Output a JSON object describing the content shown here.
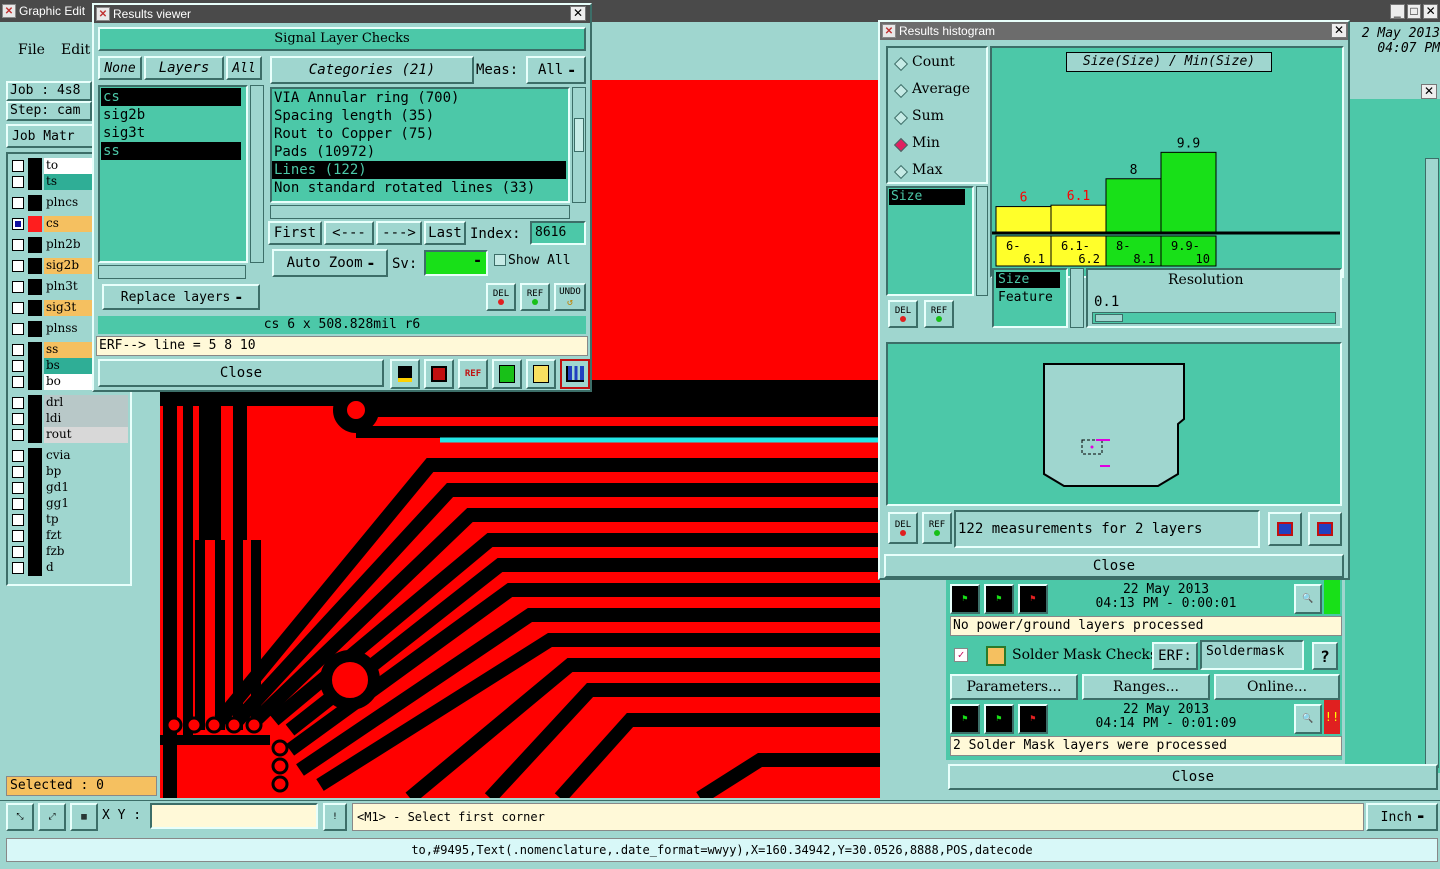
{
  "graphic_editor": {
    "title": "Graphic Edit",
    "menu": [
      "File",
      "Edit"
    ],
    "job_label": "Job : 4s8",
    "step_label": "Step: cam",
    "job_matrix_button": "Job Matr",
    "layers": [
      {
        "name": "to",
        "swatch": "#000000",
        "bg": "#ffffff",
        "checked": false
      },
      {
        "name": "ts",
        "swatch": "#000000",
        "bg": "#2fae96",
        "checked": false
      },
      {
        "name": "plncs",
        "swatch": "#000000",
        "bg": "#9fd6cf",
        "checked": false
      },
      {
        "name": "cs",
        "swatch": "#ff1e1e",
        "bg": "#f5c060",
        "checked": true
      },
      {
        "name": "pln2b",
        "swatch": "#000000",
        "bg": "#9fd6cf",
        "checked": false
      },
      {
        "name": "sig2b",
        "swatch": "#000000",
        "bg": "#f5c060",
        "checked": false
      },
      {
        "name": "pln3t",
        "swatch": "#000000",
        "bg": "#9fd6cf",
        "checked": false
      },
      {
        "name": "sig3t",
        "swatch": "#000000",
        "bg": "#f5c060",
        "checked": false
      },
      {
        "name": "plnss",
        "swatch": "#000000",
        "bg": "#9fd6cf",
        "checked": false
      },
      {
        "name": "ss",
        "swatch": "#000000",
        "bg": "#f5c060",
        "checked": false
      },
      {
        "name": "bs",
        "swatch": "#000000",
        "bg": "#2fae96",
        "checked": false
      },
      {
        "name": "bo",
        "swatch": "#000000",
        "bg": "#ffffff",
        "checked": false
      },
      {
        "name": "drl",
        "swatch": "#000000",
        "bg": "#b8c8c8",
        "checked": false
      },
      {
        "name": "ldi",
        "swatch": "#000000",
        "bg": "#b8c8c8",
        "checked": false
      },
      {
        "name": "rout",
        "swatch": "#000000",
        "bg": "#d8d8d8",
        "checked": false
      },
      {
        "name": "cvia",
        "swatch": "#000000",
        "bg": "#9fd6cf",
        "checked": false
      },
      {
        "name": "bp",
        "swatch": "#000000",
        "bg": "#9fd6cf",
        "checked": false
      },
      {
        "name": "gd1",
        "swatch": "#000000",
        "bg": "#9fd6cf",
        "checked": false
      },
      {
        "name": "gg1",
        "swatch": "#000000",
        "bg": "#9fd6cf",
        "checked": false
      },
      {
        "name": "tp",
        "swatch": "#000000",
        "bg": "#9fd6cf",
        "checked": false
      },
      {
        "name": "fzt",
        "swatch": "#000000",
        "bg": "#9fd6cf",
        "checked": false
      },
      {
        "name": "fzb",
        "swatch": "#000000",
        "bg": "#9fd6cf",
        "checked": false
      },
      {
        "name": "d",
        "swatch": "#000000",
        "bg": "#9fd6cf",
        "checked": false
      }
    ],
    "selected_label": "Selected : 0",
    "date_line1": "2 May 2013",
    "date_line2": "04:07 PM",
    "xy_label": "X Y :",
    "xy_value": "",
    "prompt": "<M1> - Select first corner",
    "units": "Inch",
    "status_line": "to,#9495,Text(.nomenclature,.date_format=wwyy),X=160.34942,Y=30.0526,8888,POS,datecode"
  },
  "results_viewer": {
    "title": "Results viewer",
    "header": "Signal Layer Checks",
    "none_btn": "None",
    "layers_btn": "Layers",
    "all_btn": "All",
    "categories_btn": "Categories (21)",
    "meas_label": "Meas:",
    "meas_value": "All",
    "layer_list": [
      {
        "name": "cs",
        "selected": true
      },
      {
        "name": "sig2b",
        "selected": false
      },
      {
        "name": "sig3t",
        "selected": false
      },
      {
        "name": "ss",
        "selected": true
      }
    ],
    "categories": [
      {
        "name": "VIA Annular ring (700)",
        "selected": false
      },
      {
        "name": "Spacing length (35)",
        "selected": false
      },
      {
        "name": "Rout to Copper (75)",
        "selected": false
      },
      {
        "name": "Pads (10972)",
        "selected": false
      },
      {
        "name": "Lines (122)",
        "selected": true
      },
      {
        "name": "Non standard rotated lines (33)",
        "selected": false
      }
    ],
    "first_btn": "First",
    "prev_btn": "<---",
    "next_btn": "--->",
    "last_btn": "Last",
    "index_label": "Index:",
    "index_value": "8616",
    "auto_zoom": "Auto Zoom",
    "sv_label": "Sv:",
    "show_all": "Show All",
    "replace_layers": "Replace layers",
    "del_label": "DEL",
    "ref_label": "REF",
    "undo_label": "UNDO",
    "measurement": "cs 6 x 508.828mil  r6",
    "erf_line": "ERF--> line = 5 8 10",
    "close_btn": "Close"
  },
  "histogram": {
    "title": "Results histogram",
    "modes": [
      {
        "label": "Count",
        "selected": false
      },
      {
        "label": "Average",
        "selected": false
      },
      {
        "label": "Sum",
        "selected": false
      },
      {
        "label": "Min",
        "selected": true
      },
      {
        "label": "Max",
        "selected": false
      }
    ],
    "list_item": "Size",
    "chart_title": "Size(Size) / Min(Size)",
    "size_label": "Size",
    "feature_label": "Feature",
    "resolution_label": "Resolution",
    "resolution_value": "0.1",
    "summary": "122 measurements for 2 layers",
    "del_label": "DEL",
    "ref_label": "REF",
    "close_btn": "Close"
  },
  "chart_data": {
    "type": "bar",
    "title": "Size(Size) / Min(Size)",
    "categories": [
      "6-\n6.1",
      "6.1-\n6.2",
      "8-\n8.1",
      "9.9-\n10"
    ],
    "category_labels": [
      [
        "6-",
        "6.1"
      ],
      [
        "6.1-",
        "6.2"
      ],
      [
        "8-",
        "8.1"
      ],
      [
        "9.9-",
        "10"
      ]
    ],
    "values": [
      6,
      6.1,
      8,
      9.9
    ],
    "value_labels": [
      "6",
      "6.1",
      "8",
      "9.9"
    ],
    "bar_colors": [
      "#ffff2a",
      "#ffff2a",
      "#18e018",
      "#18e018"
    ],
    "label_colors": [
      "#ff0000",
      "#ff0000",
      "#000000",
      "#000000"
    ],
    "ylim": [
      0,
      10.5
    ]
  },
  "checklist": {
    "row1_date": "22 May 2013",
    "row1_time": "04:13 PM - 0:00:01",
    "row1_msg": "No power/ground layers processed",
    "solder_title": "Solder Mask Checks",
    "erf_label": "ERF:",
    "erf_value": "Soldermask",
    "help": "?",
    "params_btn": "Parameters...",
    "ranges_btn": "Ranges...",
    "online_btn": "Online...",
    "row2_date": "22 May 2013",
    "row2_time": "04:14 PM - 0:01:09",
    "row2_msg": "2 Solder Mask layers were processed",
    "close_btn": "Close"
  }
}
